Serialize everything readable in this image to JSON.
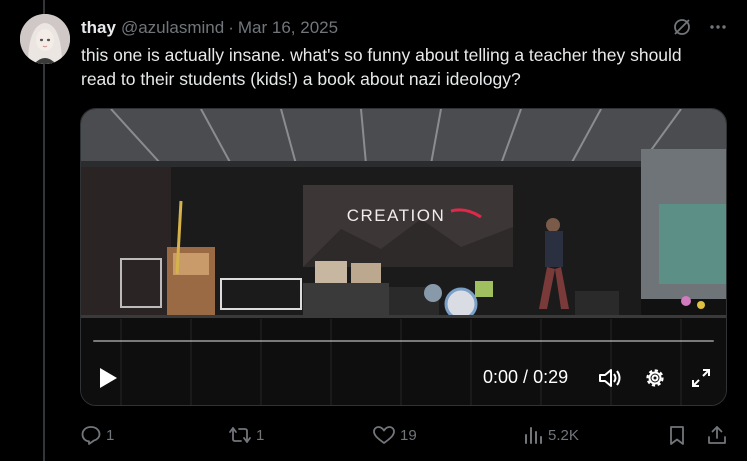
{
  "tweet": {
    "display_name": "thay",
    "handle": "@azulasmind",
    "separator": "·",
    "date": "Mar 16, 2025",
    "text": "this one is actually insane. what's so funny about telling a teacher they should read to their students (kids!) a book about nazi ideology?"
  },
  "header_icons": [
    "grok-icon",
    "more-icon"
  ],
  "video": {
    "banner_text": "CREATION",
    "current_time": "0:00",
    "time_separator": " / ",
    "duration": "0:29",
    "progress": 0,
    "controls": [
      "play-icon",
      "volume-icon",
      "settings-icon",
      "fullscreen-icon"
    ]
  },
  "actions": {
    "replies": "1",
    "reposts": "1",
    "likes": "19",
    "views": "5.2K"
  },
  "colors": {
    "background": "#000000",
    "text_primary": "#e7e9ea",
    "text_secondary": "#71767b",
    "divider": "#333639",
    "accent_red": "#e0284a"
  }
}
